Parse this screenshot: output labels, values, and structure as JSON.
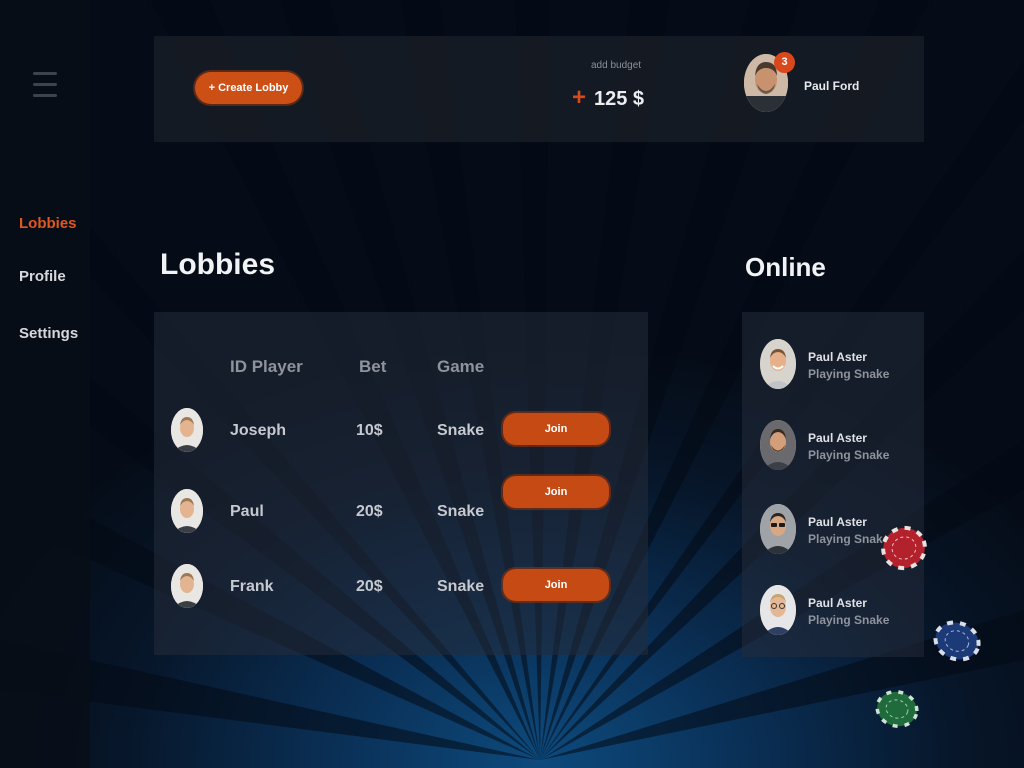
{
  "sidebar": {
    "menu_icon": "hamburger-menu-icon",
    "items": [
      {
        "label": "Lobbies",
        "active": true
      },
      {
        "label": "Profile",
        "active": false
      },
      {
        "label": "Settings",
        "active": false
      }
    ]
  },
  "topbar": {
    "create_lobby_label": "+ Create Lobby",
    "budget_label": "add budget",
    "budget_plus": "+",
    "budget_value": "125 $",
    "notification_count": "3",
    "user_name": "Paul Ford"
  },
  "lobbies": {
    "title": "Lobbies",
    "columns": {
      "player": "ID Player",
      "bet": "Bet",
      "game": "Game"
    },
    "rows": [
      {
        "player": "Joseph",
        "bet": "10$",
        "game": "Snake",
        "action": "Join"
      },
      {
        "player": "Paul",
        "bet": "20$",
        "game": "Snake",
        "action": "Join"
      },
      {
        "player": "Frank",
        "bet": "20$",
        "game": "Snake",
        "action": "Join"
      }
    ]
  },
  "online": {
    "title": "Online",
    "users": [
      {
        "name": "Paul Aster",
        "status": "Playing Snake"
      },
      {
        "name": "Paul Aster",
        "status": "Playing Snake"
      },
      {
        "name": "Paul Aster",
        "status": "Playing Snake"
      },
      {
        "name": "Paul Aster",
        "status": "Playing Snake"
      }
    ]
  },
  "colors": {
    "accent": "#cc4f16",
    "background": "#071629",
    "panel": "#242c3a",
    "chip_red": "#b3222c",
    "chip_blue": "#1c3a78",
    "chip_green": "#1f6b3c"
  }
}
